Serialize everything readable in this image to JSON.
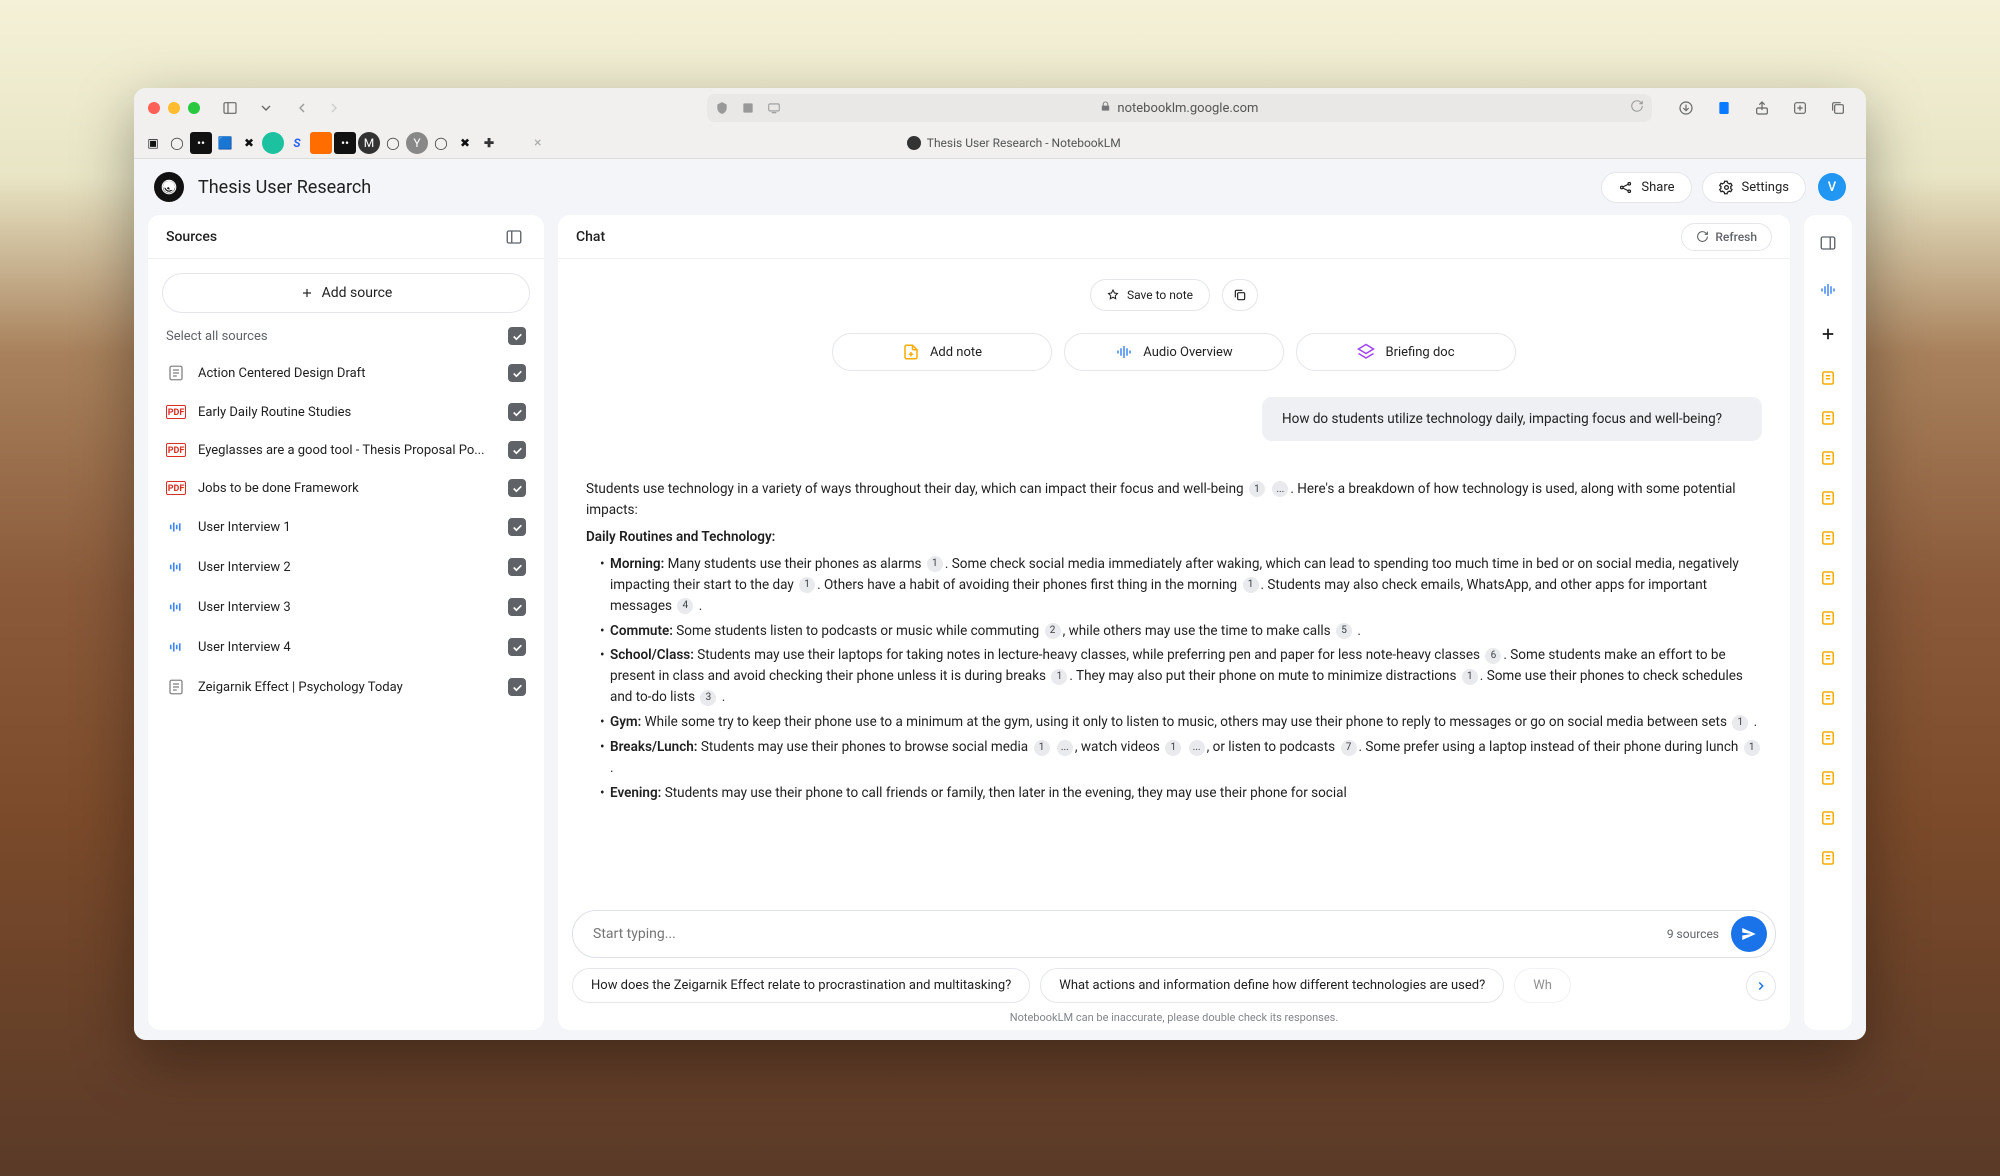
{
  "browser": {
    "url": "notebooklm.google.com",
    "tab_title": "Thesis User Research - NotebookLM"
  },
  "header": {
    "app_title": "Thesis User Research",
    "share": "Share",
    "settings": "Settings",
    "avatar_letter": "V"
  },
  "sources_panel": {
    "title": "Sources",
    "add_source": "Add source",
    "select_all": "Select all sources",
    "items": [
      {
        "type": "doc",
        "label": "Action Centered Design Draft"
      },
      {
        "type": "pdf",
        "label": "Early Daily Routine Studies"
      },
      {
        "type": "pdf",
        "label": "Eyeglasses are a good tool - Thesis Proposal Po..."
      },
      {
        "type": "pdf",
        "label": "Jobs to be done Framework"
      },
      {
        "type": "wave",
        "label": "User Interview 1"
      },
      {
        "type": "wave",
        "label": "User Interview 2"
      },
      {
        "type": "wave",
        "label": "User Interview 3"
      },
      {
        "type": "wave",
        "label": "User Interview 4"
      },
      {
        "type": "doc",
        "label": "Zeigarnik Effect | Psychology Today"
      }
    ]
  },
  "chat_panel": {
    "title": "Chat",
    "refresh": "Refresh",
    "save_to_note": "Save to note",
    "add_note": "Add note",
    "audio_overview": "Audio Overview",
    "briefing_doc": "Briefing doc",
    "user_question": "How do students utilize technology daily, impacting focus and well-being?",
    "answer_intro_pre": "Students use technology in a variety of ways throughout their day, which can impact their focus and well-being",
    "answer_intro_post": ". Here's a breakdown of how technology is used, along with some potential impacts:",
    "section_daily": "Daily Routines and Technology:",
    "bullets": {
      "morning_label": "Morning:",
      "morning_1": " Many students use their phones as alarms ",
      "morning_2": ". Some check social media immediately after waking, which can lead to spending too much time in bed or on social media, negatively impacting their start to the day ",
      "morning_3": ". Others have a habit of avoiding their phones first thing in the morning ",
      "morning_4": ". Students may also check emails, WhatsApp, and other apps for important messages ",
      "commute_label": "Commute:",
      "commute_1": " Some students listen to podcasts or music while commuting ",
      "commute_2": ", while others may use the time to make calls ",
      "school_label": "School/Class:",
      "school_1": " Students may use their laptops for taking notes in lecture-heavy classes, while preferring pen and paper for less note-heavy classes ",
      "school_2": ". Some students make an effort to be present in class and avoid checking their phone unless it is during breaks ",
      "school_3": ". They may also put their phone on mute to minimize distractions ",
      "school_4": ". Some use their phones to check schedules and to-do lists ",
      "gym_label": "Gym:",
      "gym_1": " While some try to keep their phone use to a minimum at the gym, using it only to listen to music, others may use their phone to reply to messages or go on social media between sets ",
      "breaks_label": "Breaks/Lunch:",
      "breaks_1": " Students may use their phones to browse social media ",
      "breaks_2": ", watch videos ",
      "breaks_3": ", or listen to podcasts ",
      "breaks_4": ". Some prefer using a laptop instead of their phone during lunch ",
      "evening_label": "Evening:",
      "evening_1": " Students may use their phone to call friends or family, then later in the evening, they may use their phone for social"
    },
    "input_placeholder": "Start typing...",
    "source_count": "9 sources",
    "suggestions": [
      "How does the Zeigarnik Effect relate to procrastination and multitasking?",
      "What actions and information define how different technologies are used?",
      "Wh"
    ],
    "disclaimer": "NotebookLM can be inaccurate, please double check its responses."
  }
}
